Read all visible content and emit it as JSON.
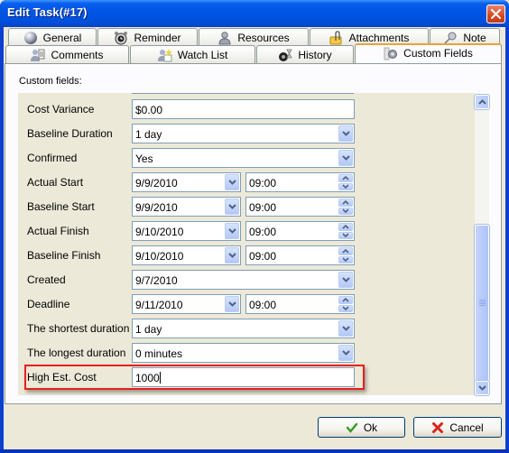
{
  "window": {
    "title": "Edit Task(#17)",
    "close_icon": "close-icon"
  },
  "tabs": {
    "row1": [
      {
        "label": "General",
        "icon": "sphere-icon"
      },
      {
        "label": "Reminder",
        "icon": "alarm-clock-icon"
      },
      {
        "label": "Resources",
        "icon": "user-icon"
      },
      {
        "label": "Attachments",
        "icon": "paperclip-folder-icon"
      },
      {
        "label": "Note",
        "icon": "pushpin-icon"
      }
    ],
    "row2": [
      {
        "label": "Comments",
        "icon": "comments-icon"
      },
      {
        "label": "Watch List",
        "icon": "watch-list-icon"
      },
      {
        "label": "History",
        "icon": "history-icon"
      },
      {
        "label": "Custom Fields",
        "icon": "custom-fields-icon",
        "active": true
      }
    ]
  },
  "panel": {
    "section_label": "Custom fields:",
    "fields": [
      {
        "label": "Cost Variance",
        "type": "text",
        "value": "$0.00"
      },
      {
        "label": "Baseline Duration",
        "type": "dropdown",
        "value": "1 day"
      },
      {
        "label": "Confirmed",
        "type": "dropdown",
        "value": "Yes"
      },
      {
        "label": "Actual Start",
        "type": "datetime",
        "date": "9/9/2010",
        "time": "09:00"
      },
      {
        "label": "Baseline Start",
        "type": "datetime",
        "date": "9/9/2010",
        "time": "09:00"
      },
      {
        "label": "Actual Finish",
        "type": "datetime",
        "date": "9/10/2010",
        "time": "09:00"
      },
      {
        "label": "Baseline Finish",
        "type": "datetime",
        "date": "9/10/2010",
        "time": "09:00"
      },
      {
        "label": "Created",
        "type": "date-dropdown",
        "value": "9/7/2010"
      },
      {
        "label": "Deadline",
        "type": "datetime",
        "date": "9/11/2010",
        "time": "09:00"
      },
      {
        "label": "The shortest duration",
        "type": "dropdown",
        "value": "1 day"
      },
      {
        "label": "The longest duration",
        "type": "dropdown",
        "value": "0 minutes"
      },
      {
        "label": "High Est. Cost",
        "type": "text",
        "value": "1000",
        "focused": true,
        "highlighted": true
      }
    ],
    "scrollbar": {
      "position_fraction": 0.45,
      "visible_fraction": 0.55
    }
  },
  "buttons": {
    "ok": {
      "label": "Ok",
      "icon": "checkmark-icon"
    },
    "cancel": {
      "label": "Cancel",
      "icon": "x-icon"
    }
  },
  "colors": {
    "title_bar": "#0054e3",
    "active_tab_accent": "#e8a33c",
    "highlight_box": "#e8201c",
    "panel_bg": "#ece9d8"
  }
}
